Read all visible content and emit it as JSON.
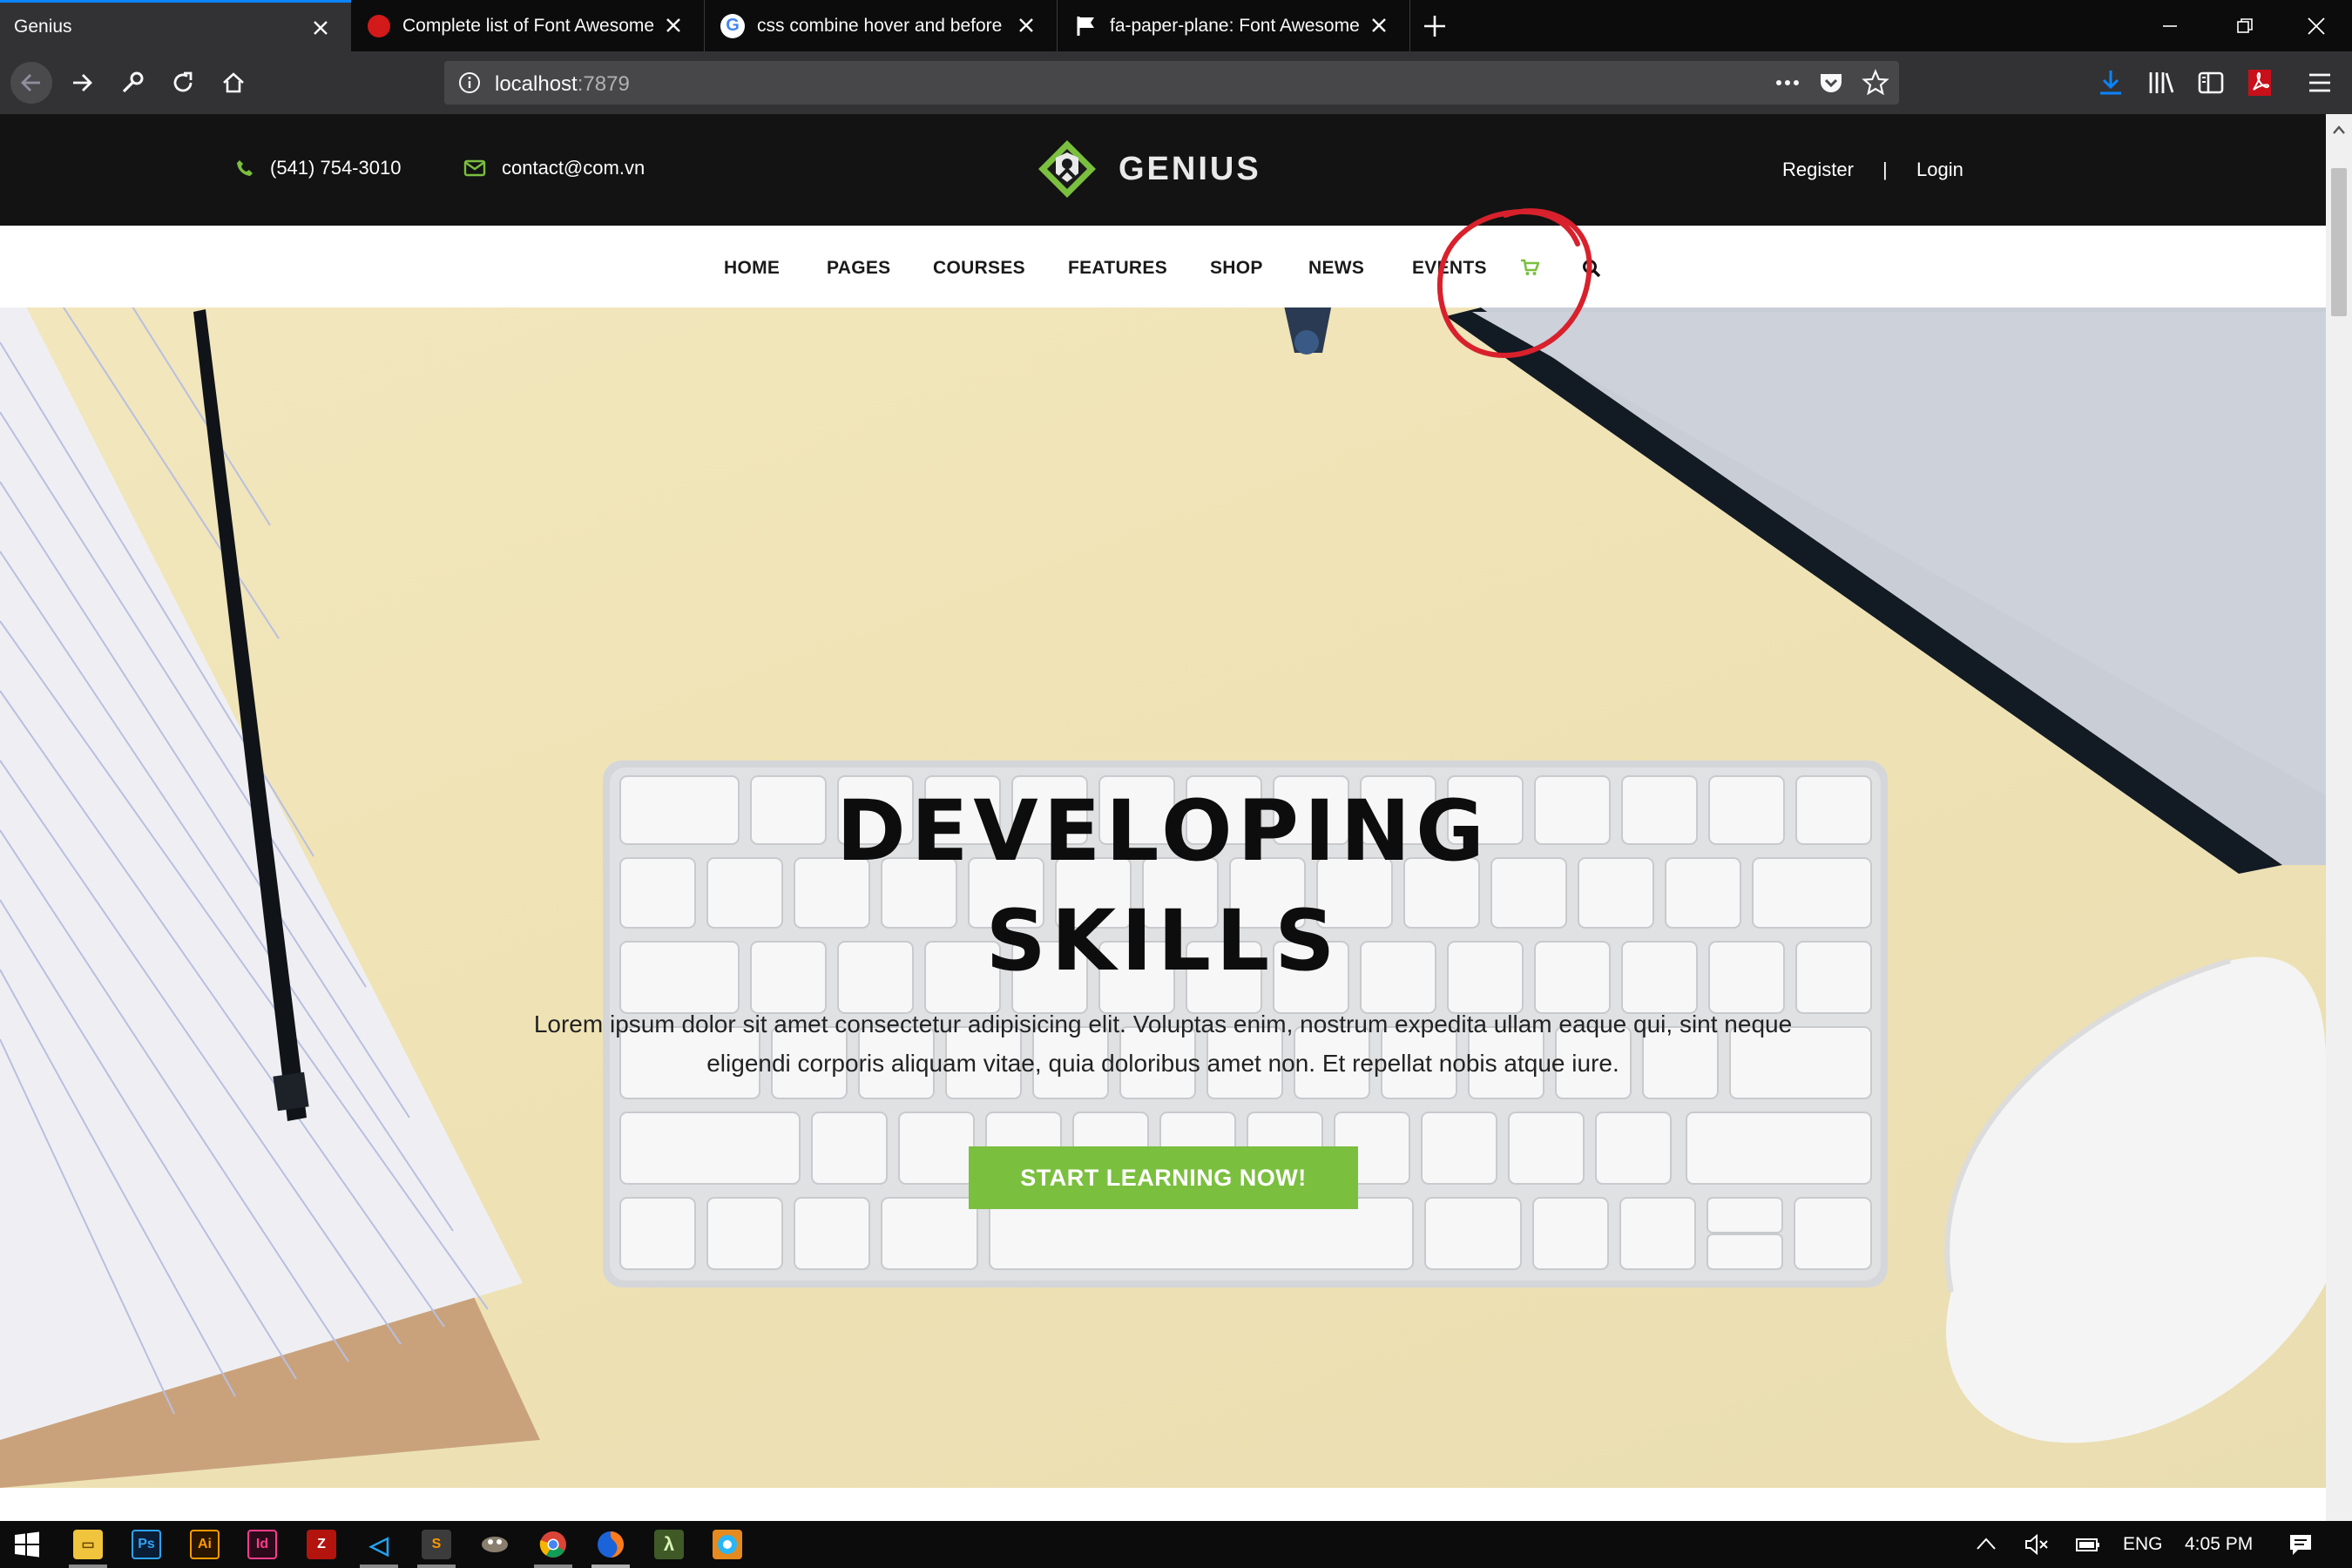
{
  "browser": {
    "tabs": [
      {
        "title": "Genius",
        "active": true
      },
      {
        "title": "Complete list of Font Awesome",
        "active": false
      },
      {
        "title": "css combine hover and before",
        "active": false
      },
      {
        "title": "fa-paper-plane: Font Awesome",
        "active": false
      }
    ],
    "url_host": "localhost",
    "url_port": ":7879"
  },
  "site": {
    "phone": "(541) 754-3010",
    "email": "contact@com.vn",
    "logo_text": "GENIUS",
    "register": "Register",
    "separator": "|",
    "login": "Login",
    "nav": [
      "HOME",
      "PAGES",
      "COURSES",
      "FEATURES",
      "SHOP",
      "NEWS",
      "EVENTS"
    ],
    "hero": {
      "title_line1": "DEVELOPING",
      "title_line2": "SKILLS",
      "text_line1": "Lorem ipsum dolor sit amet consectetur adipisicing elit. Voluptas enim, nostrum expedita ullam eaque qui, sint neque",
      "text_line2": "eligendi corporis aliquam vitae, quia doloribus amet non. Et repellat nobis atque iure.",
      "cta": "START LEARNING NOW!"
    }
  },
  "taskbar": {
    "apps": [
      "file-explorer",
      "photoshop",
      "illustrator",
      "indesign",
      "filezilla",
      "vscode",
      "sublime",
      "gimp",
      "chrome",
      "firefox",
      "lambda",
      "app"
    ],
    "app_labels": {
      "photoshop": "Ps",
      "illustrator": "Ai",
      "indesign": "Id",
      "lambda": "λ"
    },
    "lang": "ENG",
    "time": "4:05 PM"
  },
  "colors": {
    "accent_green": "#7bbf3f",
    "topbar_bg": "#131313",
    "annotation_red": "#d8212c",
    "browser_accent": "#0a84ff"
  }
}
